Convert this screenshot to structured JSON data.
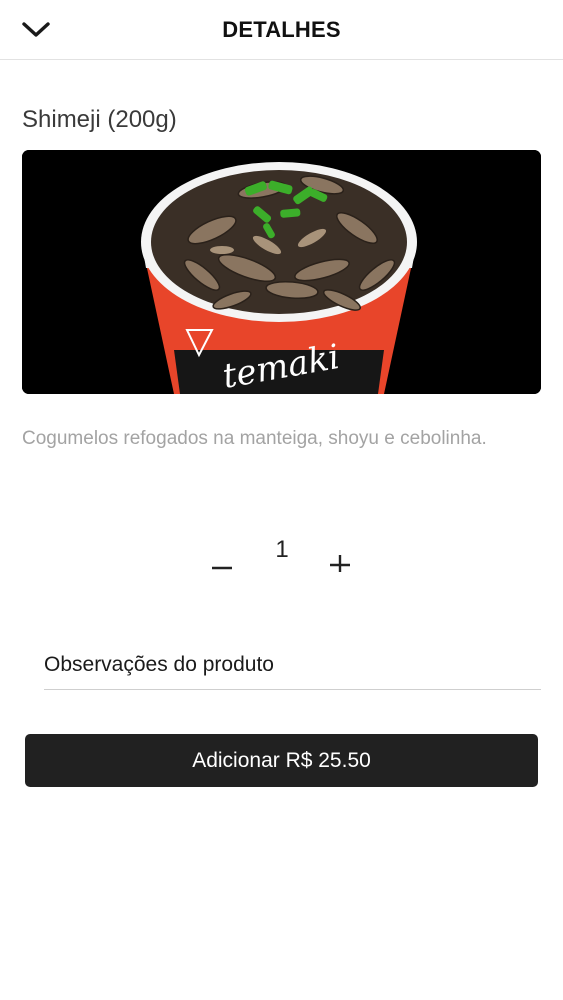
{
  "header": {
    "title": "DETALHES",
    "back_icon": "chevron-down-icon"
  },
  "product": {
    "name": "Shimeji (200g)",
    "image_label": "temaki",
    "description": "Cogumelos refogados na manteiga, shoyu e cebolinha."
  },
  "quantity": {
    "value": "1",
    "minus_icon": "minus-icon",
    "plus_icon": "plus-icon"
  },
  "notes": {
    "placeholder": "Observações do produto"
  },
  "add_button": {
    "label": "Adicionar R$ 25.50"
  },
  "colors": {
    "button_bg": "#212121",
    "description_text": "#a3a3a3",
    "divider": "#e2e2e2",
    "cup_red": "#e8452a"
  }
}
